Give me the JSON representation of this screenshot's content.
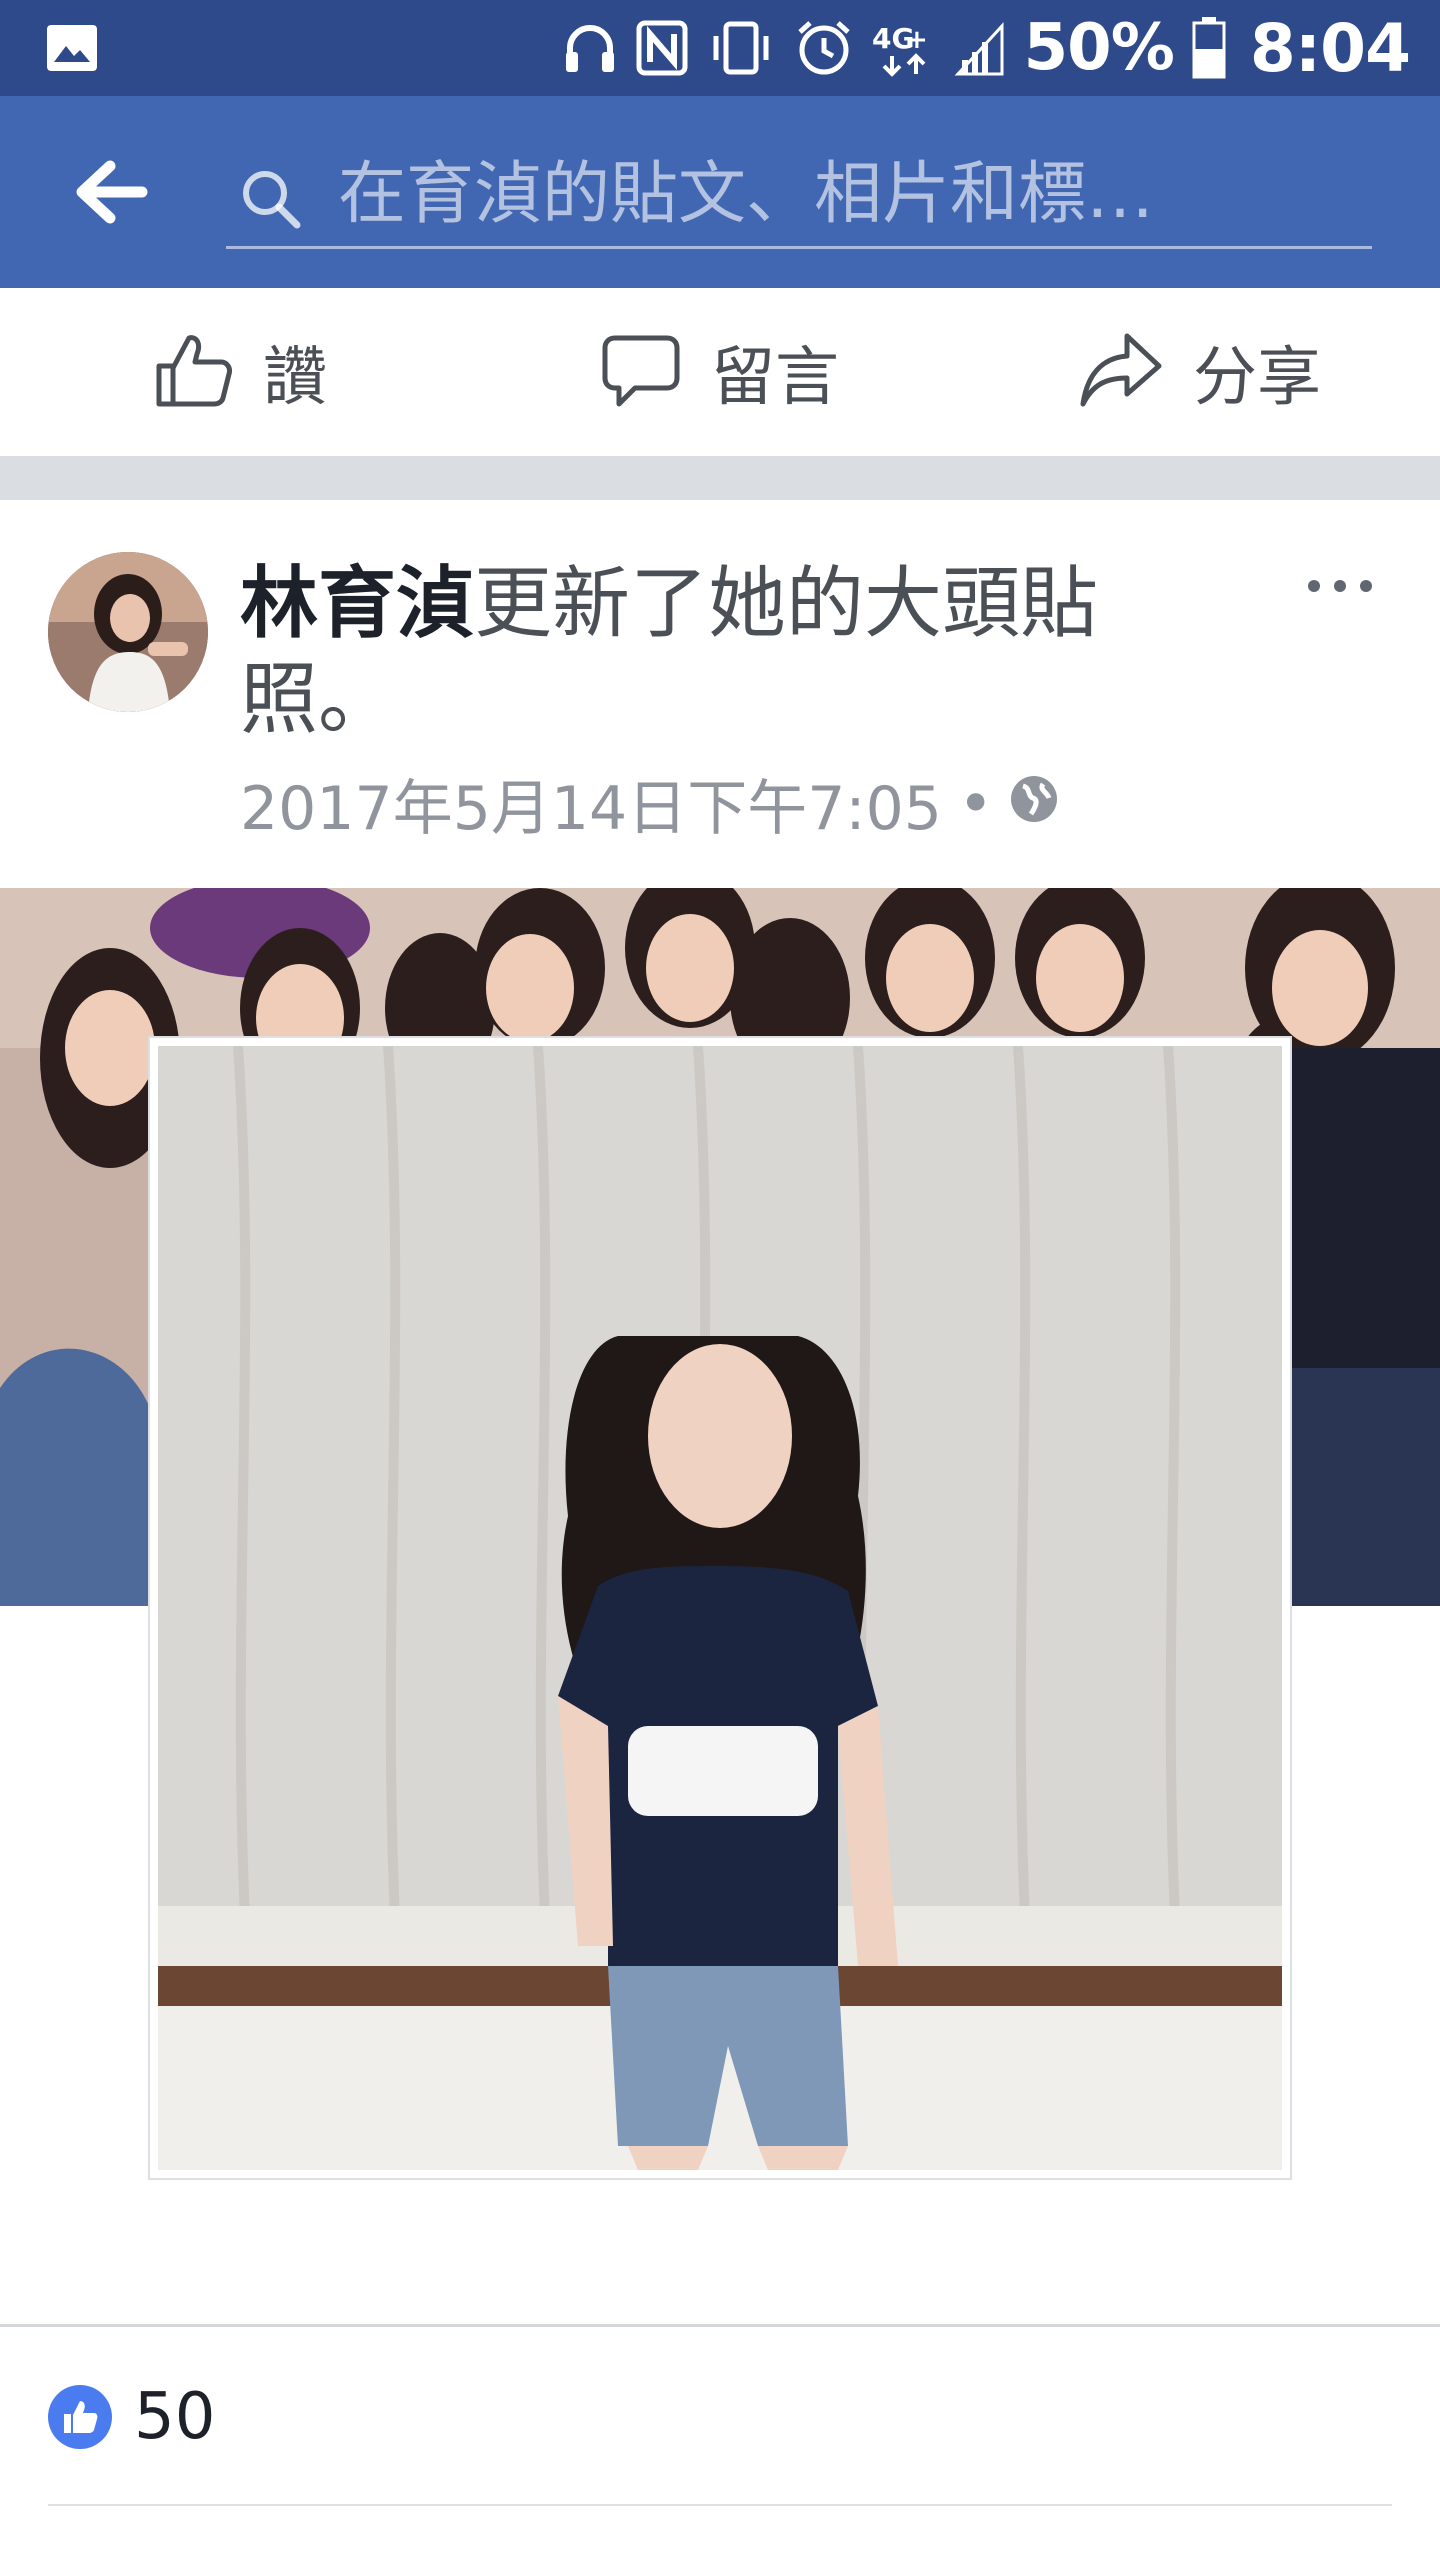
{
  "status_bar": {
    "battery": "50%",
    "time": "8:04",
    "icons": [
      "image-icon",
      "headphones-icon",
      "nfc-icon",
      "vibrate-icon",
      "alarm-icon",
      "network-4g-icon",
      "signal-icon",
      "battery-icon"
    ]
  },
  "header": {
    "search_placeholder": "在育湞的貼文、相片和標…",
    "icons": [
      "back-arrow-icon",
      "search-icon"
    ]
  },
  "actions": {
    "like_label": "讚",
    "comment_label": "留言",
    "share_label": "分享"
  },
  "post": {
    "author": "林育湞",
    "action_text": "更新了她的大頭貼照。",
    "timestamp": "2017年5月14日下午7:05",
    "separator": "•",
    "privacy_icon": "globe-icon",
    "like_count": "50"
  },
  "colors": {
    "status_bar": "#2f4a8a",
    "header": "#4267b2",
    "like_blue": "#4a7cf0",
    "gap_gray": "#dadde1"
  }
}
